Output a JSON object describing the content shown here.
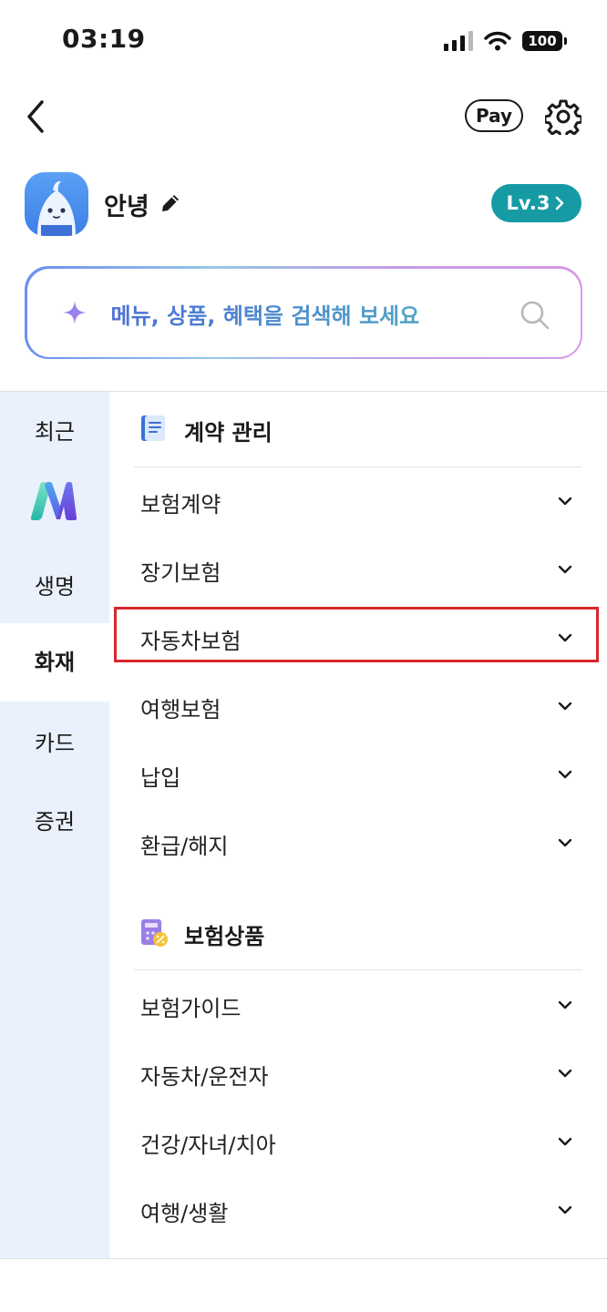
{
  "status_bar": {
    "time": "03:19",
    "battery": "100"
  },
  "nav": {
    "pay_label": "Pay"
  },
  "profile": {
    "name": "안녕",
    "level": "Lv.3"
  },
  "search": {
    "placeholder": "메뉴, 상품, 혜택을 검색해 보세요"
  },
  "rail": {
    "recent": "최근",
    "life": "생명",
    "fire": "화재",
    "card": "카드",
    "securities": "증권"
  },
  "contract_section": {
    "title": "계약 관리",
    "items": [
      "보험계약",
      "장기보험",
      "자동차보험",
      "여행보험",
      "납입",
      "환급/해지"
    ]
  },
  "product_section": {
    "title": "보험상품",
    "items": [
      "보험가이드",
      "자동차/운전자",
      "건강/자녀/치아",
      "여행/생활"
    ]
  },
  "colors": {
    "accent_teal": "#169ba5",
    "rail_bg": "#eaf1fd",
    "highlight_red": "#d9262c"
  }
}
